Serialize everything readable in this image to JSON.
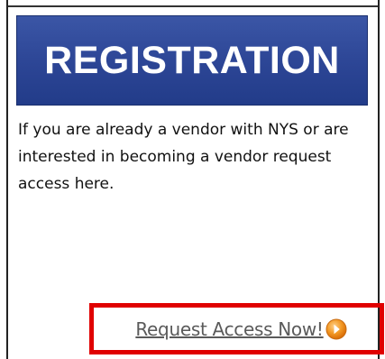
{
  "registration": {
    "title": "REGISTRATION",
    "description": "If you are already a vendor with NYS or are interested in becoming a vendor request access here.",
    "cta_label": "Request Access Now!",
    "cta_icon": "orange-arrow-circle-icon"
  },
  "colors": {
    "banner": "#2c4595",
    "highlight_border": "#e00000",
    "icon_accent": "#f28c1a"
  }
}
